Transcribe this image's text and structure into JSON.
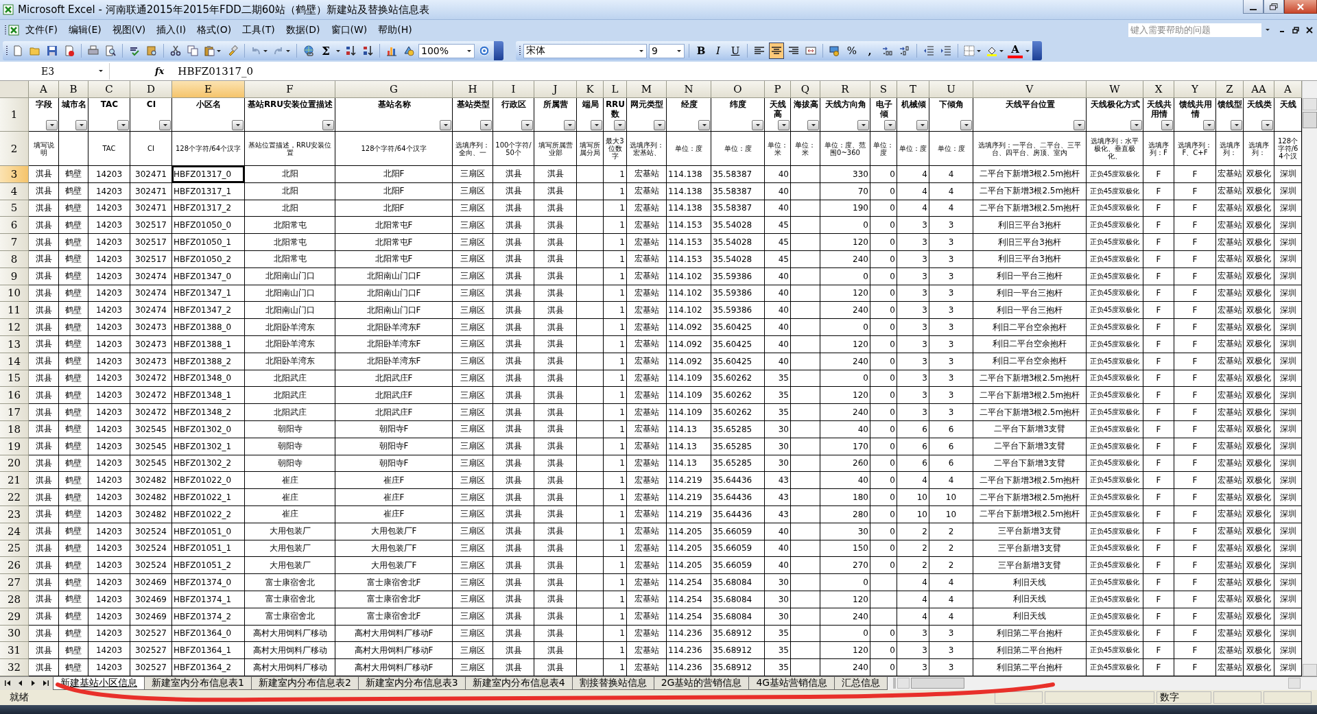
{
  "window": {
    "title": "Microsoft Excel - 河南联通2015年2015年FDD二期60站（鹤壁）新建站及替换站信息表"
  },
  "menu": [
    "文件(F)",
    "编辑(E)",
    "视图(V)",
    "插入(I)",
    "格式(O)",
    "工具(T)",
    "数据(D)",
    "窗口(W)",
    "帮助(H)"
  ],
  "help_box": {
    "placeholder": "键入需要帮助的问题"
  },
  "standard_toolbar": {
    "sum": "Σ",
    "zoom": "100%"
  },
  "formatting_toolbar": {
    "font": "宋体",
    "size": "9",
    "style_buttons": [
      "B",
      "I",
      "U"
    ],
    "alignment": [
      {
        "selected": false
      },
      {
        "selected": true
      },
      {
        "selected": false
      }
    ],
    "percent": "%",
    "comma": ",",
    "font_color": "A"
  },
  "formula_bar": {
    "name_box": "E3",
    "fx": "fx",
    "value": "HBFZ01317_0"
  },
  "columns": [
    {
      "letter": "A",
      "selected": false
    },
    {
      "letter": "B",
      "selected": false
    },
    {
      "letter": "C",
      "selected": false
    },
    {
      "letter": "D",
      "selected": false
    },
    {
      "letter": "E",
      "selected": true
    },
    {
      "letter": "F",
      "selected": false
    },
    {
      "letter": "G",
      "selected": false
    },
    {
      "letter": "H",
      "selected": false
    },
    {
      "letter": "I",
      "selected": false
    },
    {
      "letter": "J",
      "selected": false
    },
    {
      "letter": "K",
      "selected": false
    },
    {
      "letter": "L",
      "selected": false
    },
    {
      "letter": "M",
      "selected": false
    },
    {
      "letter": "N",
      "selected": false
    },
    {
      "letter": "O",
      "selected": false
    },
    {
      "letter": "P",
      "selected": false
    },
    {
      "letter": "Q",
      "selected": false
    },
    {
      "letter": "R",
      "selected": false
    },
    {
      "letter": "S",
      "selected": false
    },
    {
      "letter": "T",
      "selected": false
    },
    {
      "letter": "U",
      "selected": false
    },
    {
      "letter": "V",
      "selected": false
    },
    {
      "letter": "W",
      "selected": false
    },
    {
      "letter": "X",
      "selected": false
    },
    {
      "letter": "Y",
      "selected": false
    },
    {
      "letter": "Z",
      "selected": false
    },
    {
      "letter": "AA",
      "selected": false
    },
    {
      "letter": "A",
      "selected": false
    }
  ],
  "header_rows": [
    {
      "number": "1",
      "selected": false,
      "cells": {
        "A": "字段",
        "B": "城市名",
        "C": "TAC",
        "D": "CI",
        "E": "小区名",
        "F": "基站RRU安装位置描述",
        "G": "基站名称",
        "H": "基站类型",
        "I": "行政区",
        "J": "所属营",
        "K": "端局",
        "L": "RRU数",
        "M": "网元类型",
        "N": "经度",
        "O": "纬度",
        "P": "天线高",
        "Q": "海拔高",
        "R": "天线方向角",
        "S": "电子倾",
        "T": "机械倾",
        "U": "下倾角",
        "V": "天线平台位置",
        "W": "天线极化方式",
        "X": "天线共用情",
        "Y": "馈线共用情",
        "Z": "馈线型",
        "AA": "天线类",
        "AB": "天线"
      }
    },
    {
      "number": "2",
      "selected": false,
      "cells": {
        "A": "填写说明",
        "C": "TAC",
        "D": "CI",
        "E": "128个字符/64个汉字",
        "F": "基站位置描述，RRU安装位置",
        "G": "128个字符/64个汉字",
        "H": "选填序列：全向、一",
        "I": "100个字符/50个",
        "J": "填写所属营业部",
        "K": "填写所属分局",
        "L": "最大3位数字",
        "M": "选填序列：宏基站、",
        "N": "单位：度",
        "O": "单位：度",
        "P": "单位：米",
        "Q": "单位：米",
        "R": "单位：度、范围0~360",
        "S": "单位：度",
        "T": "单位：度",
        "U": "单位：度",
        "V": "选填序列：一平台、二平台、三平台、四平台、房顶、室内",
        "W": "选填序列：水平极化、垂直极化、",
        "X": "选填序列：F",
        "Y": "选填序列：F、C+F",
        "Z": "选填序列：",
        "AA": "选填序列：",
        "AB": "128个字符/64个汉"
      }
    }
  ],
  "rows": [
    {
      "number": "3",
      "selected": true,
      "cells": {
        "A": "淇县",
        "B": "鹤壁",
        "C": "14203",
        "D": "302471",
        "E": "HBFZ01317_0",
        "F": "北阳",
        "G": "北阳F",
        "H": "三扇区",
        "I": "淇县",
        "J": "淇县",
        "L": "1",
        "M": "宏基站",
        "N": "114.138",
        "O": "35.58387",
        "P": "40",
        "R": "330",
        "S": "0",
        "T": "4",
        "U": "4",
        "V": "二平台下新增3根2.5m抱杆",
        "W": "正负45度双极化",
        "X": "F",
        "Y": "F",
        "Z": "宏基站",
        "AA": "双极化",
        "AB": "深圳"
      }
    },
    {
      "number": "4",
      "selected": false,
      "cells": {
        "A": "淇县",
        "B": "鹤壁",
        "C": "14203",
        "D": "302471",
        "E": "HBFZ01317_1",
        "F": "北阳",
        "G": "北阳F",
        "H": "三扇区",
        "I": "淇县",
        "J": "淇县",
        "L": "1",
        "M": "宏基站",
        "N": "114.138",
        "O": "35.58387",
        "P": "40",
        "R": "70",
        "S": "0",
        "T": "4",
        "U": "4",
        "V": "二平台下新增3根2.5m抱杆",
        "W": "正负45度双极化",
        "X": "F",
        "Y": "F",
        "Z": "宏基站",
        "AA": "双极化",
        "AB": "深圳"
      }
    },
    {
      "number": "5",
      "selected": false,
      "cells": {
        "A": "淇县",
        "B": "鹤壁",
        "C": "14203",
        "D": "302471",
        "E": "HBFZ01317_2",
        "F": "北阳",
        "G": "北阳F",
        "H": "三扇区",
        "I": "淇县",
        "J": "淇县",
        "L": "1",
        "M": "宏基站",
        "N": "114.138",
        "O": "35.58387",
        "P": "40",
        "R": "190",
        "S": "0",
        "T": "4",
        "U": "4",
        "V": "二平台下新增3根2.5m抱杆",
        "W": "正负45度双极化",
        "X": "F",
        "Y": "F",
        "Z": "宏基站",
        "AA": "双极化",
        "AB": "深圳"
      }
    },
    {
      "number": "6",
      "selected": false,
      "cells": {
        "A": "淇县",
        "B": "鹤壁",
        "C": "14203",
        "D": "302517",
        "E": "HBFZ01050_0",
        "F": "北阳常屯",
        "G": "北阳常屯F",
        "H": "三扇区",
        "I": "淇县",
        "J": "淇县",
        "L": "1",
        "M": "宏基站",
        "N": "114.153",
        "O": "35.54028",
        "P": "45",
        "R": "0",
        "S": "0",
        "T": "3",
        "U": "3",
        "V": "利旧三平台3抱杆",
        "W": "正负45度双极化",
        "X": "F",
        "Y": "F",
        "Z": "宏基站",
        "AA": "双极化",
        "AB": "深圳"
      }
    },
    {
      "number": "7",
      "selected": false,
      "cells": {
        "A": "淇县",
        "B": "鹤壁",
        "C": "14203",
        "D": "302517",
        "E": "HBFZ01050_1",
        "F": "北阳常屯",
        "G": "北阳常屯F",
        "H": "三扇区",
        "I": "淇县",
        "J": "淇县",
        "L": "1",
        "M": "宏基站",
        "N": "114.153",
        "O": "35.54028",
        "P": "45",
        "R": "120",
        "S": "0",
        "T": "3",
        "U": "3",
        "V": "利旧三平台3抱杆",
        "W": "正负45度双极化",
        "X": "F",
        "Y": "F",
        "Z": "宏基站",
        "AA": "双极化",
        "AB": "深圳"
      }
    },
    {
      "number": "8",
      "selected": false,
      "cells": {
        "A": "淇县",
        "B": "鹤壁",
        "C": "14203",
        "D": "302517",
        "E": "HBFZ01050_2",
        "F": "北阳常屯",
        "G": "北阳常屯F",
        "H": "三扇区",
        "I": "淇县",
        "J": "淇县",
        "L": "1",
        "M": "宏基站",
        "N": "114.153",
        "O": "35.54028",
        "P": "45",
        "R": "240",
        "S": "0",
        "T": "3",
        "U": "3",
        "V": "利旧三平台3抱杆",
        "W": "正负45度双极化",
        "X": "F",
        "Y": "F",
        "Z": "宏基站",
        "AA": "双极化",
        "AB": "深圳"
      }
    },
    {
      "number": "9",
      "selected": false,
      "cells": {
        "A": "淇县",
        "B": "鹤壁",
        "C": "14203",
        "D": "302474",
        "E": "HBFZ01347_0",
        "F": "北阳南山门口",
        "G": "北阳南山门口F",
        "H": "三扇区",
        "I": "淇县",
        "J": "淇县",
        "L": "1",
        "M": "宏基站",
        "N": "114.102",
        "O": "35.59386",
        "P": "40",
        "R": "0",
        "S": "0",
        "T": "3",
        "U": "3",
        "V": "利旧一平台三抱杆",
        "W": "正负45度双极化",
        "X": "F",
        "Y": "F",
        "Z": "宏基站",
        "AA": "双极化",
        "AB": "深圳"
      }
    },
    {
      "number": "10",
      "selected": false,
      "cells": {
        "A": "淇县",
        "B": "鹤壁",
        "C": "14203",
        "D": "302474",
        "E": "HBFZ01347_1",
        "F": "北阳南山门口",
        "G": "北阳南山门口F",
        "H": "三扇区",
        "I": "淇县",
        "J": "淇县",
        "L": "1",
        "M": "宏基站",
        "N": "114.102",
        "O": "35.59386",
        "P": "40",
        "R": "120",
        "S": "0",
        "T": "3",
        "U": "3",
        "V": "利旧一平台三抱杆",
        "W": "正负45度双极化",
        "X": "F",
        "Y": "F",
        "Z": "宏基站",
        "AA": "双极化",
        "AB": "深圳"
      }
    },
    {
      "number": "11",
      "selected": false,
      "cells": {
        "A": "淇县",
        "B": "鹤壁",
        "C": "14203",
        "D": "302474",
        "E": "HBFZ01347_2",
        "F": "北阳南山门口",
        "G": "北阳南山门口F",
        "H": "三扇区",
        "I": "淇县",
        "J": "淇县",
        "L": "1",
        "M": "宏基站",
        "N": "114.102",
        "O": "35.59386",
        "P": "40",
        "R": "240",
        "S": "0",
        "T": "3",
        "U": "3",
        "V": "利旧一平台三抱杆",
        "W": "正负45度双极化",
        "X": "F",
        "Y": "F",
        "Z": "宏基站",
        "AA": "双极化",
        "AB": "深圳"
      }
    },
    {
      "number": "12",
      "selected": false,
      "cells": {
        "A": "淇县",
        "B": "鹤壁",
        "C": "14203",
        "D": "302473",
        "E": "HBFZ01388_0",
        "F": "北阳卧羊湾东",
        "G": "北阳卧羊湾东F",
        "H": "三扇区",
        "I": "淇县",
        "J": "淇县",
        "L": "1",
        "M": "宏基站",
        "N": "114.092",
        "O": "35.60425",
        "P": "40",
        "R": "0",
        "S": "0",
        "T": "3",
        "U": "3",
        "V": "利旧二平台空余抱杆",
        "W": "正负45度双极化",
        "X": "F",
        "Y": "F",
        "Z": "宏基站",
        "AA": "双极化",
        "AB": "深圳"
      }
    },
    {
      "number": "13",
      "selected": false,
      "cells": {
        "A": "淇县",
        "B": "鹤壁",
        "C": "14203",
        "D": "302473",
        "E": "HBFZ01388_1",
        "F": "北阳卧羊湾东",
        "G": "北阳卧羊湾东F",
        "H": "三扇区",
        "I": "淇县",
        "J": "淇县",
        "L": "1",
        "M": "宏基站",
        "N": "114.092",
        "O": "35.60425",
        "P": "40",
        "R": "120",
        "S": "0",
        "T": "3",
        "U": "3",
        "V": "利旧二平台空余抱杆",
        "W": "正负45度双极化",
        "X": "F",
        "Y": "F",
        "Z": "宏基站",
        "AA": "双极化",
        "AB": "深圳"
      }
    },
    {
      "number": "14",
      "selected": false,
      "cells": {
        "A": "淇县",
        "B": "鹤壁",
        "C": "14203",
        "D": "302473",
        "E": "HBFZ01388_2",
        "F": "北阳卧羊湾东",
        "G": "北阳卧羊湾东F",
        "H": "三扇区",
        "I": "淇县",
        "J": "淇县",
        "L": "1",
        "M": "宏基站",
        "N": "114.092",
        "O": "35.60425",
        "P": "40",
        "R": "240",
        "S": "0",
        "T": "3",
        "U": "3",
        "V": "利旧二平台空余抱杆",
        "W": "正负45度双极化",
        "X": "F",
        "Y": "F",
        "Z": "宏基站",
        "AA": "双极化",
        "AB": "深圳"
      }
    },
    {
      "number": "15",
      "selected": false,
      "cells": {
        "A": "淇县",
        "B": "鹤壁",
        "C": "14203",
        "D": "302472",
        "E": "HBFZ01348_0",
        "F": "北阳武庄",
        "G": "北阳武庄F",
        "H": "三扇区",
        "I": "淇县",
        "J": "淇县",
        "L": "1",
        "M": "宏基站",
        "N": "114.109",
        "O": "35.60262",
        "P": "35",
        "R": "0",
        "S": "0",
        "T": "3",
        "U": "3",
        "V": "二平台下新增3根2.5m抱杆",
        "W": "正负45度双极化",
        "X": "F",
        "Y": "F",
        "Z": "宏基站",
        "AA": "双极化",
        "AB": "深圳"
      }
    },
    {
      "number": "16",
      "selected": false,
      "cells": {
        "A": "淇县",
        "B": "鹤壁",
        "C": "14203",
        "D": "302472",
        "E": "HBFZ01348_1",
        "F": "北阳武庄",
        "G": "北阳武庄F",
        "H": "三扇区",
        "I": "淇县",
        "J": "淇县",
        "L": "1",
        "M": "宏基站",
        "N": "114.109",
        "O": "35.60262",
        "P": "35",
        "R": "120",
        "S": "0",
        "T": "3",
        "U": "3",
        "V": "二平台下新增3根2.5m抱杆",
        "W": "正负45度双极化",
        "X": "F",
        "Y": "F",
        "Z": "宏基站",
        "AA": "双极化",
        "AB": "深圳"
      }
    },
    {
      "number": "17",
      "selected": false,
      "cells": {
        "A": "淇县",
        "B": "鹤壁",
        "C": "14203",
        "D": "302472",
        "E": "HBFZ01348_2",
        "F": "北阳武庄",
        "G": "北阳武庄F",
        "H": "三扇区",
        "I": "淇县",
        "J": "淇县",
        "L": "1",
        "M": "宏基站",
        "N": "114.109",
        "O": "35.60262",
        "P": "35",
        "R": "240",
        "S": "0",
        "T": "3",
        "U": "3",
        "V": "二平台下新增3根2.5m抱杆",
        "W": "正负45度双极化",
        "X": "F",
        "Y": "F",
        "Z": "宏基站",
        "AA": "双极化",
        "AB": "深圳"
      }
    },
    {
      "number": "18",
      "selected": false,
      "cells": {
        "A": "淇县",
        "B": "鹤壁",
        "C": "14203",
        "D": "302545",
        "E": "HBFZ01302_0",
        "F": "朝阳寺",
        "G": "朝阳寺F",
        "H": "三扇区",
        "I": "淇县",
        "J": "淇县",
        "L": "1",
        "M": "宏基站",
        "N": "114.13",
        "O": "35.65285",
        "P": "30",
        "R": "40",
        "S": "0",
        "T": "6",
        "U": "6",
        "V": "二平台下新增3支臂",
        "W": "正负45度双极化",
        "X": "F",
        "Y": "F",
        "Z": "宏基站",
        "AA": "双极化",
        "AB": "深圳"
      }
    },
    {
      "number": "19",
      "selected": false,
      "cells": {
        "A": "淇县",
        "B": "鹤壁",
        "C": "14203",
        "D": "302545",
        "E": "HBFZ01302_1",
        "F": "朝阳寺",
        "G": "朝阳寺F",
        "H": "三扇区",
        "I": "淇县",
        "J": "淇县",
        "L": "1",
        "M": "宏基站",
        "N": "114.13",
        "O": "35.65285",
        "P": "30",
        "R": "170",
        "S": "0",
        "T": "6",
        "U": "6",
        "V": "二平台下新增3支臂",
        "W": "正负45度双极化",
        "X": "F",
        "Y": "F",
        "Z": "宏基站",
        "AA": "双极化",
        "AB": "深圳"
      }
    },
    {
      "number": "20",
      "selected": false,
      "cells": {
        "A": "淇县",
        "B": "鹤壁",
        "C": "14203",
        "D": "302545",
        "E": "HBFZ01302_2",
        "F": "朝阳寺",
        "G": "朝阳寺F",
        "H": "三扇区",
        "I": "淇县",
        "J": "淇县",
        "L": "1",
        "M": "宏基站",
        "N": "114.13",
        "O": "35.65285",
        "P": "30",
        "R": "260",
        "S": "0",
        "T": "6",
        "U": "6",
        "V": "二平台下新增3支臂",
        "W": "正负45度双极化",
        "X": "F",
        "Y": "F",
        "Z": "宏基站",
        "AA": "双极化",
        "AB": "深圳"
      }
    },
    {
      "number": "21",
      "selected": false,
      "cells": {
        "A": "淇县",
        "B": "鹤壁",
        "C": "14203",
        "D": "302482",
        "E": "HBFZ01022_0",
        "F": "崔庄",
        "G": "崔庄F",
        "H": "三扇区",
        "I": "淇县",
        "J": "淇县",
        "L": "1",
        "M": "宏基站",
        "N": "114.219",
        "O": "35.64436",
        "P": "43",
        "R": "40",
        "S": "0",
        "T": "4",
        "U": "4",
        "V": "二平台下新增3根2.5m抱杆",
        "W": "正负45度双极化",
        "X": "F",
        "Y": "F",
        "Z": "宏基站",
        "AA": "双极化",
        "AB": "深圳"
      }
    },
    {
      "number": "22",
      "selected": false,
      "cells": {
        "A": "淇县",
        "B": "鹤壁",
        "C": "14203",
        "D": "302482",
        "E": "HBFZ01022_1",
        "F": "崔庄",
        "G": "崔庄F",
        "H": "三扇区",
        "I": "淇县",
        "J": "淇县",
        "L": "1",
        "M": "宏基站",
        "N": "114.219",
        "O": "35.64436",
        "P": "43",
        "R": "180",
        "S": "0",
        "T": "10",
        "U": "10",
        "V": "二平台下新增3根2.5m抱杆",
        "W": "正负45度双极化",
        "X": "F",
        "Y": "F",
        "Z": "宏基站",
        "AA": "双极化",
        "AB": "深圳"
      }
    },
    {
      "number": "23",
      "selected": false,
      "cells": {
        "A": "淇县",
        "B": "鹤壁",
        "C": "14203",
        "D": "302482",
        "E": "HBFZ01022_2",
        "F": "崔庄",
        "G": "崔庄F",
        "H": "三扇区",
        "I": "淇县",
        "J": "淇县",
        "L": "1",
        "M": "宏基站",
        "N": "114.219",
        "O": "35.64436",
        "P": "43",
        "R": "280",
        "S": "0",
        "T": "10",
        "U": "10",
        "V": "二平台下新增3根2.5m抱杆",
        "W": "正负45度双极化",
        "X": "F",
        "Y": "F",
        "Z": "宏基站",
        "AA": "双极化",
        "AB": "深圳"
      }
    },
    {
      "number": "24",
      "selected": false,
      "cells": {
        "A": "淇县",
        "B": "鹤壁",
        "C": "14203",
        "D": "302524",
        "E": "HBFZ01051_0",
        "F": "大用包装厂",
        "G": "大用包装厂F",
        "H": "三扇区",
        "I": "淇县",
        "J": "淇县",
        "L": "1",
        "M": "宏基站",
        "N": "114.205",
        "O": "35.66059",
        "P": "40",
        "R": "30",
        "S": "0",
        "T": "2",
        "U": "2",
        "V": "三平台新增3支臂",
        "W": "正负45度双极化",
        "X": "F",
        "Y": "F",
        "Z": "宏基站",
        "AA": "双极化",
        "AB": "深圳"
      }
    },
    {
      "number": "25",
      "selected": false,
      "cells": {
        "A": "淇县",
        "B": "鹤壁",
        "C": "14203",
        "D": "302524",
        "E": "HBFZ01051_1",
        "F": "大用包装厂",
        "G": "大用包装厂F",
        "H": "三扇区",
        "I": "淇县",
        "J": "淇县",
        "L": "1",
        "M": "宏基站",
        "N": "114.205",
        "O": "35.66059",
        "P": "40",
        "R": "150",
        "S": "0",
        "T": "2",
        "U": "2",
        "V": "三平台新增3支臂",
        "W": "正负45度双极化",
        "X": "F",
        "Y": "F",
        "Z": "宏基站",
        "AA": "双极化",
        "AB": "深圳"
      }
    },
    {
      "number": "26",
      "selected": false,
      "cells": {
        "A": "淇县",
        "B": "鹤壁",
        "C": "14203",
        "D": "302524",
        "E": "HBFZ01051_2",
        "F": "大用包装厂",
        "G": "大用包装厂F",
        "H": "三扇区",
        "I": "淇县",
        "J": "淇县",
        "L": "1",
        "M": "宏基站",
        "N": "114.205",
        "O": "35.66059",
        "P": "40",
        "R": "270",
        "S": "0",
        "T": "2",
        "U": "2",
        "V": "三平台新增3支臂",
        "W": "正负45度双极化",
        "X": "F",
        "Y": "F",
        "Z": "宏基站",
        "AA": "双极化",
        "AB": "深圳"
      }
    },
    {
      "number": "27",
      "selected": false,
      "cells": {
        "A": "淇县",
        "B": "鹤壁",
        "C": "14203",
        "D": "302469",
        "E": "HBFZ01374_0",
        "F": "富士康宿舍北",
        "G": "富士康宿舍北F",
        "H": "三扇区",
        "I": "淇县",
        "J": "淇县",
        "L": "1",
        "M": "宏基站",
        "N": "114.254",
        "O": "35.68084",
        "P": "30",
        "R": "0",
        "T": "4",
        "U": "4",
        "V": "利旧天线",
        "W": "正负45度双极化",
        "X": "F",
        "Y": "F",
        "Z": "宏基站",
        "AA": "双极化",
        "AB": "深圳"
      }
    },
    {
      "number": "28",
      "selected": false,
      "cells": {
        "A": "淇县",
        "B": "鹤壁",
        "C": "14203",
        "D": "302469",
        "E": "HBFZ01374_1",
        "F": "富士康宿舍北",
        "G": "富士康宿舍北F",
        "H": "三扇区",
        "I": "淇县",
        "J": "淇县",
        "L": "1",
        "M": "宏基站",
        "N": "114.254",
        "O": "35.68084",
        "P": "30",
        "R": "120",
        "T": "4",
        "U": "4",
        "V": "利旧天线",
        "W": "正负45度双极化",
        "X": "F",
        "Y": "F",
        "Z": "宏基站",
        "AA": "双极化",
        "AB": "深圳"
      }
    },
    {
      "number": "29",
      "selected": false,
      "cells": {
        "A": "淇县",
        "B": "鹤壁",
        "C": "14203",
        "D": "302469",
        "E": "HBFZ01374_2",
        "F": "富士康宿舍北",
        "G": "富士康宿舍北F",
        "H": "三扇区",
        "I": "淇县",
        "J": "淇县",
        "L": "1",
        "M": "宏基站",
        "N": "114.254",
        "O": "35.68084",
        "P": "30",
        "R": "240",
        "T": "4",
        "U": "4",
        "V": "利旧天线",
        "W": "正负45度双极化",
        "X": "F",
        "Y": "F",
        "Z": "宏基站",
        "AA": "双极化",
        "AB": "深圳"
      }
    },
    {
      "number": "30",
      "selected": false,
      "cells": {
        "A": "淇县",
        "B": "鹤壁",
        "C": "14203",
        "D": "302527",
        "E": "HBFZ01364_0",
        "F": "高村大用饲料厂移动",
        "G": "高村大用饲料厂移动F",
        "H": "三扇区",
        "I": "淇县",
        "J": "淇县",
        "L": "1",
        "M": "宏基站",
        "N": "114.236",
        "O": "35.68912",
        "P": "35",
        "R": "0",
        "S": "0",
        "T": "3",
        "U": "3",
        "V": "利旧第二平台抱杆",
        "W": "正负45度双极化",
        "X": "F",
        "Y": "F",
        "Z": "宏基站",
        "AA": "双极化",
        "AB": "深圳"
      }
    },
    {
      "number": "31",
      "selected": false,
      "cells": {
        "A": "淇县",
        "B": "鹤壁",
        "C": "14203",
        "D": "302527",
        "E": "HBFZ01364_1",
        "F": "高村大用饲料厂移动",
        "G": "高村大用饲料厂移动F",
        "H": "三扇区",
        "I": "淇县",
        "J": "淇县",
        "L": "1",
        "M": "宏基站",
        "N": "114.236",
        "O": "35.68912",
        "P": "35",
        "R": "120",
        "S": "0",
        "T": "3",
        "U": "3",
        "V": "利旧第二平台抱杆",
        "W": "正负45度双极化",
        "X": "F",
        "Y": "F",
        "Z": "宏基站",
        "AA": "双极化",
        "AB": "深圳"
      }
    },
    {
      "number": "32",
      "selected": false,
      "cells": {
        "A": "淇县",
        "B": "鹤壁",
        "C": "14203",
        "D": "302527",
        "E": "HBFZ01364_2",
        "F": "高村大用饲料厂移动",
        "G": "高村大用饲料厂移动F",
        "H": "三扇区",
        "I": "淇县",
        "J": "淇县",
        "L": "1",
        "M": "宏基站",
        "N": "114.236",
        "O": "35.68912",
        "P": "35",
        "R": "240",
        "S": "0",
        "T": "3",
        "U": "3",
        "V": "利旧第二平台抱杆",
        "W": "正负45度双极化",
        "X": "F",
        "Y": "F",
        "Z": "宏基站",
        "AA": "双极化",
        "AB": "深圳"
      }
    }
  ],
  "sheet_tabs": [
    {
      "label": "新建基站小区信息",
      "selected": true
    },
    {
      "label": "新建室内分布信息表1",
      "selected": false
    },
    {
      "label": "新建室内分布信息表2",
      "selected": false
    },
    {
      "label": "新建室内分布信息表3",
      "selected": false
    },
    {
      "label": "新建室内分布信息表4",
      "selected": false
    },
    {
      "label": "割接替换站信息",
      "selected": false
    },
    {
      "label": "2G基站的营销信息",
      "selected": false
    },
    {
      "label": "4G基站营销信息",
      "selected": false
    },
    {
      "label": "汇总信息",
      "selected": false
    }
  ],
  "status_bar": {
    "status": "就绪",
    "mode": "数字"
  }
}
